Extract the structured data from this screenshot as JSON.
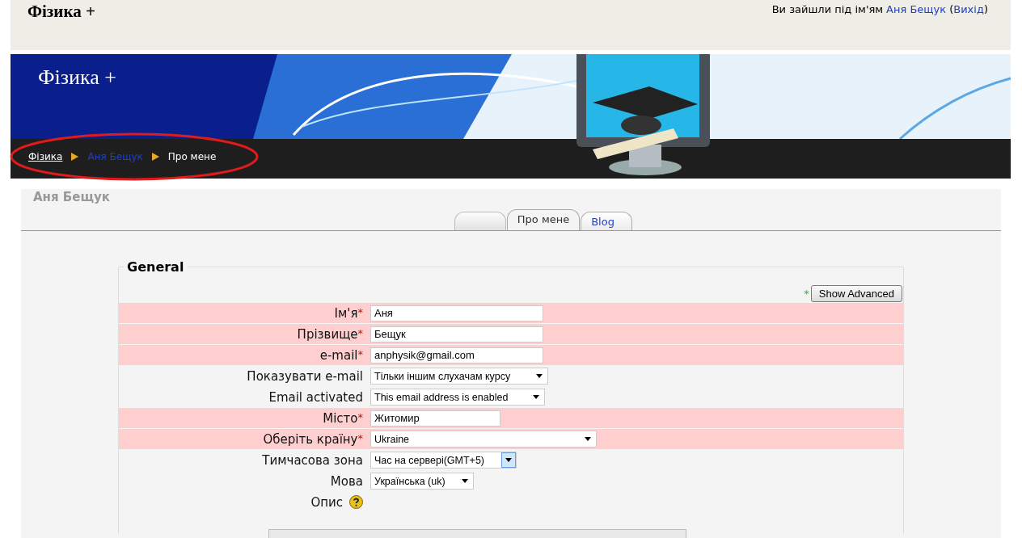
{
  "header": {
    "site_name": "Фізика +",
    "login_prefix": "Ви зайшли під ім'ям",
    "user_link": "Аня Бещук",
    "open_paren": "(",
    "logout_link": "Вихід",
    "close_paren": ")"
  },
  "banner": {
    "title": "Фізика +",
    "kind": "picture"
  },
  "breadcrumb": {
    "circled": true,
    "items": [
      {
        "label": "Фізика",
        "kind": "link"
      },
      {
        "label": "Аня Бещук",
        "kind": "user"
      },
      {
        "label": "Про мене",
        "kind": "current"
      }
    ]
  },
  "page_title": "Аня Бещук",
  "tabs": [
    {
      "selected": false,
      "disabled": true
    },
    {
      "label": "Про мене",
      "selected": true,
      "disabled": false
    },
    {
      "label": "Blog",
      "selected": false,
      "disabled": false
    }
  ],
  "form": {
    "legend": "General",
    "advanced_mark": "*",
    "advanced_button": "Show Advanced",
    "required_mark": "*",
    "fields": [
      {
        "label": "Ім'я",
        "kind": "text",
        "required": true,
        "value": "Аня"
      },
      {
        "label": "Прізвище",
        "kind": "text",
        "required": true,
        "value": "Бещук"
      },
      {
        "label": "e-mail",
        "kind": "text",
        "required": true,
        "value": "anphysik@gmail.com"
      },
      {
        "label": "Показувати e-mail",
        "kind": "select",
        "required": false,
        "value": "Тільки іншим слухачам курсу"
      },
      {
        "label": "Email activated",
        "kind": "select",
        "required": false,
        "value": "This email address is enabled"
      },
      {
        "label": "Місто",
        "kind": "text",
        "required": true,
        "value": "Житомир"
      },
      {
        "label": "Оберіть країну",
        "kind": "select",
        "required": true,
        "value": "Ukraine"
      },
      {
        "label": "Тимчасова зона",
        "kind": "select",
        "required": false,
        "value": "Час на сервері(GMT+5)",
        "focused": true
      },
      {
        "label": "Мова",
        "kind": "select",
        "required": false,
        "value": "Українська (uk)"
      },
      {
        "label": "Опис",
        "kind": "help",
        "required": false
      }
    ]
  }
}
